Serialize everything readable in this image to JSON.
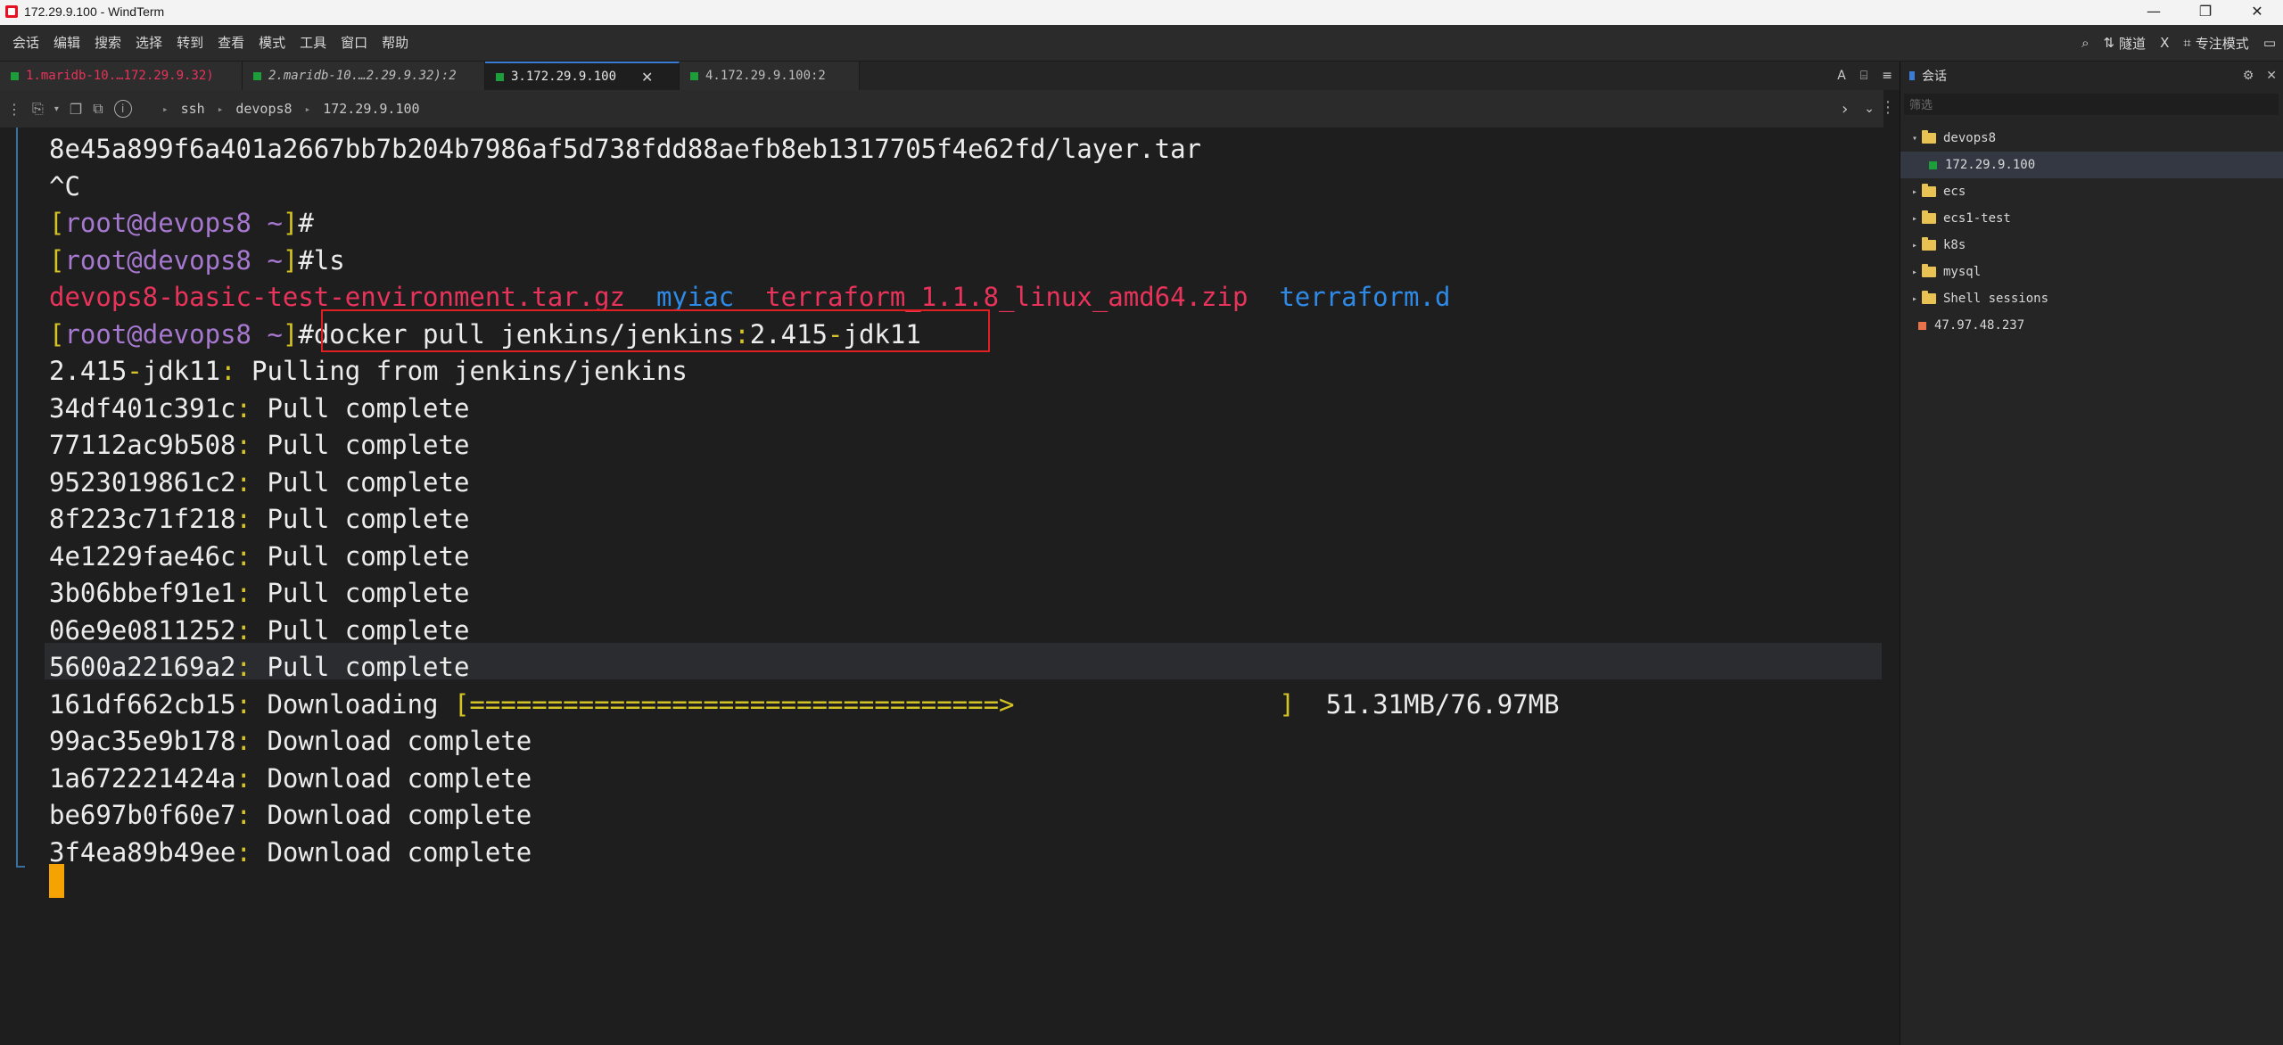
{
  "window": {
    "title": "172.29.9.100 - WindTerm",
    "controls": [
      "—",
      "❐",
      "✕"
    ]
  },
  "menu": {
    "items": [
      "会话",
      "编辑",
      "搜索",
      "选择",
      "转到",
      "查看",
      "模式",
      "工具",
      "窗口",
      "帮助"
    ],
    "right": {
      "search_icon": "⌕",
      "tunnel_label": "隧道",
      "x_label": "X",
      "focus_label": "专注模式",
      "layout_icon": "▭"
    }
  },
  "tabs": [
    {
      "label": "1.maridb-10.…172.29.9.32)",
      "color": "#e8335a",
      "active": false
    },
    {
      "label": "2.maridb-10.…2.29.9.32):2",
      "color": "#bdbdbd",
      "active": false
    },
    {
      "label": "3.172.29.9.100",
      "color": "#e6e6e6",
      "active": true
    },
    {
      "label": "4.172.29.9.100:2",
      "color": "#bdbdbd",
      "active": false
    }
  ],
  "tab_tools": {
    "font": "A",
    "menu": "≡"
  },
  "pathbar": {
    "crumbs": [
      "ssh",
      "devops8",
      "172.29.9.100"
    ],
    "sep": "▸"
  },
  "terminal": {
    "lines": [
      {
        "segs": [
          {
            "t": "8e45a899f6a401a2667bb7b204b7986af5d738fdd88aefb8eb1317705f4e62fd/layer.tar",
            "c": "c-white"
          }
        ]
      },
      {
        "segs": [
          {
            "t": "^C",
            "c": "c-white"
          }
        ]
      },
      {
        "segs": [
          {
            "t": "[",
            "c": "c-yellow"
          },
          {
            "t": "root@devops8 ~",
            "c": "c-purple"
          },
          {
            "t": "]",
            "c": "c-yellow"
          },
          {
            "t": "#",
            "c": "c-white"
          }
        ]
      },
      {
        "segs": [
          {
            "t": "[",
            "c": "c-yellow"
          },
          {
            "t": "root@devops8 ~",
            "c": "c-purple"
          },
          {
            "t": "]",
            "c": "c-yellow"
          },
          {
            "t": "#ls",
            "c": "c-white"
          }
        ]
      },
      {
        "segs": [
          {
            "t": "devops8-basic-test-environment.tar.gz",
            "c": "c-red"
          },
          {
            "t": "  ",
            "c": "c-white"
          },
          {
            "t": "myiac",
            "c": "c-blue"
          },
          {
            "t": "  ",
            "c": "c-white"
          },
          {
            "t": "terraform_1.1.8_linux_amd64.zip",
            "c": "c-red"
          },
          {
            "t": "  ",
            "c": "c-white"
          },
          {
            "t": "terraform.d",
            "c": "c-blue"
          }
        ]
      },
      {
        "segs": [
          {
            "t": "[",
            "c": "c-yellow"
          },
          {
            "t": "root@devops8 ~",
            "c": "c-purple"
          },
          {
            "t": "]",
            "c": "c-yellow"
          },
          {
            "t": "#docker pull jenkins/jenkins",
            "c": "c-white"
          },
          {
            "t": ":",
            "c": "c-yellow"
          },
          {
            "t": "2.415",
            "c": "c-white"
          },
          {
            "t": "-",
            "c": "c-yellow"
          },
          {
            "t": "jdk11",
            "c": "c-white"
          }
        ]
      },
      {
        "segs": [
          {
            "t": "2.415",
            "c": "c-white"
          },
          {
            "t": "-",
            "c": "c-yellow"
          },
          {
            "t": "jdk11",
            "c": "c-white"
          },
          {
            "t": ":",
            "c": "c-yellow"
          },
          {
            "t": " Pulling from jenkins/jenkins",
            "c": "c-white"
          }
        ]
      },
      {
        "segs": [
          {
            "t": "34df401c391c",
            "c": "c-white"
          },
          {
            "t": ":",
            "c": "c-yellow"
          },
          {
            "t": " Pull complete",
            "c": "c-white"
          }
        ]
      },
      {
        "segs": [
          {
            "t": "77112ac9b508",
            "c": "c-white"
          },
          {
            "t": ":",
            "c": "c-yellow"
          },
          {
            "t": " Pull complete",
            "c": "c-white"
          }
        ]
      },
      {
        "segs": [
          {
            "t": "9523019861c2",
            "c": "c-white"
          },
          {
            "t": ":",
            "c": "c-yellow"
          },
          {
            "t": " Pull complete",
            "c": "c-white"
          }
        ]
      },
      {
        "segs": [
          {
            "t": "8f223c71f218",
            "c": "c-white"
          },
          {
            "t": ":",
            "c": "c-yellow"
          },
          {
            "t": " Pull complete",
            "c": "c-white"
          }
        ]
      },
      {
        "segs": [
          {
            "t": "4e1229fae46c",
            "c": "c-white"
          },
          {
            "t": ":",
            "c": "c-yellow"
          },
          {
            "t": " Pull complete",
            "c": "c-white"
          }
        ]
      },
      {
        "segs": [
          {
            "t": "3b06bbef91e1",
            "c": "c-white"
          },
          {
            "t": ":",
            "c": "c-yellow"
          },
          {
            "t": " Pull complete",
            "c": "c-white"
          }
        ]
      },
      {
        "segs": [
          {
            "t": "06e9e0811252",
            "c": "c-white"
          },
          {
            "t": ":",
            "c": "c-yellow"
          },
          {
            "t": " Pull complete",
            "c": "c-white"
          }
        ]
      },
      {
        "segs": [
          {
            "t": "5600a22169a2",
            "c": "c-white"
          },
          {
            "t": ":",
            "c": "c-yellow"
          },
          {
            "t": " Pull complete",
            "c": "c-white"
          }
        ],
        "highlight": true
      },
      {
        "segs": [
          {
            "t": "161df662cb15",
            "c": "c-white"
          },
          {
            "t": ":",
            "c": "c-yellow"
          },
          {
            "t": " Downloading ",
            "c": "c-white"
          },
          {
            "t": "[==================================>                 ]",
            "c": "c-yellow"
          },
          {
            "t": "  51.31MB/76.97MB",
            "c": "c-white"
          }
        ]
      },
      {
        "segs": [
          {
            "t": "99ac35e9b178",
            "c": "c-white"
          },
          {
            "t": ":",
            "c": "c-yellow"
          },
          {
            "t": " Download complete",
            "c": "c-white"
          }
        ]
      },
      {
        "segs": [
          {
            "t": "1a672221424a",
            "c": "c-white"
          },
          {
            "t": ":",
            "c": "c-yellow"
          },
          {
            "t": " Download complete",
            "c": "c-white"
          }
        ]
      },
      {
        "segs": [
          {
            "t": "be697b0f60e7",
            "c": "c-white"
          },
          {
            "t": ":",
            "c": "c-yellow"
          },
          {
            "t": " Download complete",
            "c": "c-white"
          }
        ]
      },
      {
        "segs": [
          {
            "t": "3f4ea89b49ee",
            "c": "c-white"
          },
          {
            "t": ":",
            "c": "c-yellow"
          },
          {
            "t": " Download complete",
            "c": "c-white"
          }
        ]
      }
    ]
  },
  "sidebar": {
    "title": "会话",
    "filter_placeholder": "筛选",
    "tree": [
      {
        "label": "devops8",
        "kind": "folder",
        "expanded": true,
        "indent": 0
      },
      {
        "label": "172.29.9.100",
        "kind": "session-green",
        "indent": 2,
        "selected": true
      },
      {
        "label": "ecs",
        "kind": "folder",
        "expanded": false,
        "indent": 0
      },
      {
        "label": "ecs1-test",
        "kind": "folder",
        "expanded": false,
        "indent": 0
      },
      {
        "label": "k8s",
        "kind": "folder",
        "expanded": false,
        "indent": 0
      },
      {
        "label": "mysql",
        "kind": "folder",
        "expanded": false,
        "indent": 0
      },
      {
        "label": "Shell sessions",
        "kind": "folder",
        "expanded": false,
        "indent": 0
      },
      {
        "label": "47.97.48.237",
        "kind": "session-orange",
        "indent": 1
      }
    ]
  }
}
